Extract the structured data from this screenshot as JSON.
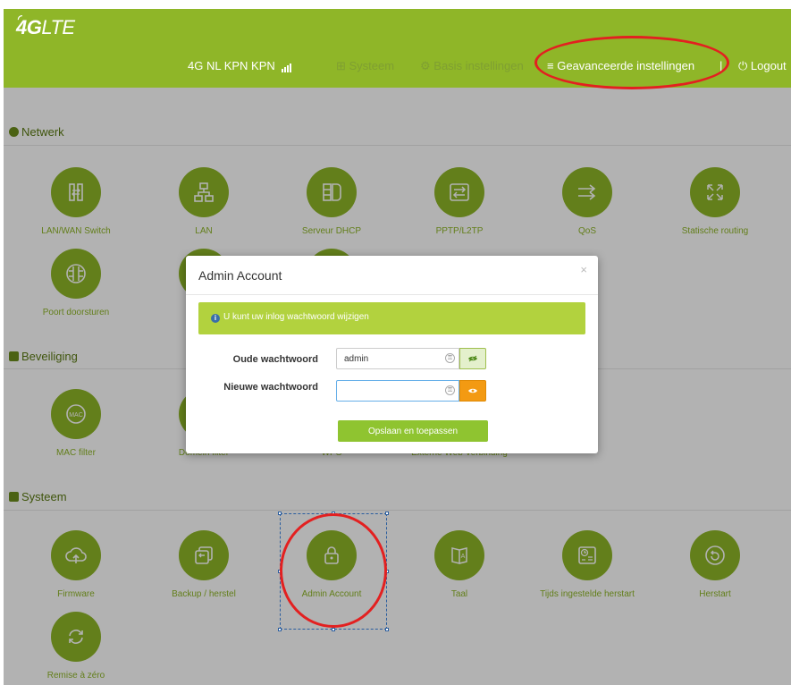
{
  "header": {
    "logo_bold": "4G",
    "logo_light": "LTE",
    "network_status": "4G  NL KPN KPN",
    "nav": {
      "systeem": "Systeem",
      "basis": "Basis instellingen",
      "geavanceerd": "Geavanceerde instellingen",
      "separator": "|",
      "logout": "Logout"
    }
  },
  "sections": {
    "netwerk": {
      "title": "Netwerk",
      "tiles": [
        {
          "label": "LAN/WAN Switch",
          "icon": "switch-icon"
        },
        {
          "label": "LAN",
          "icon": "lan-icon"
        },
        {
          "label": "Serveur DHCP",
          "icon": "dhcp-icon"
        },
        {
          "label": "PPTP/L2TP",
          "icon": "vpn-icon"
        },
        {
          "label": "QoS",
          "icon": "qos-icon"
        },
        {
          "label": "Statische routing",
          "icon": "routing-icon"
        },
        {
          "label": "Poort doorsturen",
          "icon": "port-forward-icon"
        }
      ]
    },
    "beveiliging": {
      "title": "Beveiliging",
      "tiles": [
        {
          "label": "MAC filter",
          "icon": "mac-icon"
        },
        {
          "label": "Domein filter",
          "icon": "domain-icon"
        },
        {
          "label": "WPS",
          "icon": "wps-icon"
        },
        {
          "label": "Externe Web Verbinding",
          "icon": "web-icon"
        }
      ]
    },
    "systeem": {
      "title": "Systeem",
      "tiles": [
        {
          "label": "Firmware",
          "icon": "upload-cloud-icon"
        },
        {
          "label": "Backup / herstel",
          "icon": "backup-icon"
        },
        {
          "label": "Admin Account",
          "icon": "lock-icon"
        },
        {
          "label": "Taal",
          "icon": "language-icon"
        },
        {
          "label": "Tijds ingestelde herstart",
          "icon": "schedule-icon"
        },
        {
          "label": "Herstart",
          "icon": "restart-icon"
        },
        {
          "label": "Remise à zéro",
          "icon": "reset-icon"
        }
      ]
    }
  },
  "modal": {
    "title": "Admin Account",
    "close": "×",
    "alert": "U kunt uw inlog wachtwoord wijzigen",
    "old_label": "Oude wachtwoord",
    "old_value": "admin",
    "new_label": "Nieuwe wachtwoord",
    "new_value": "",
    "save": "Opslaan en toepassen"
  },
  "colors": {
    "brand_green": "#8fb628",
    "alert_green": "#b2d23e",
    "eye_orange": "#f39a12",
    "annotation_red": "#e32020"
  }
}
